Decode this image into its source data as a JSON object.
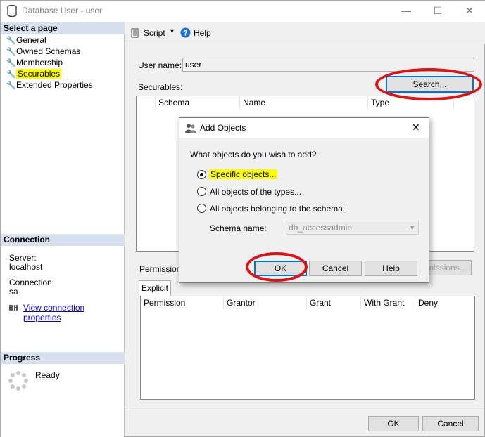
{
  "window": {
    "title": "Database User - user"
  },
  "left": {
    "select_page_header": "Select a page",
    "pages": [
      {
        "label": "General"
      },
      {
        "label": "Owned Schemas"
      },
      {
        "label": "Membership"
      },
      {
        "label": "Securables"
      },
      {
        "label": "Extended Properties"
      }
    ],
    "connection_header": "Connection",
    "server_label": "Server:",
    "server_value": "localhost",
    "connection_label": "Connection:",
    "connection_value": "sa",
    "view_props_link": "View connection properties",
    "progress_header": "Progress",
    "progress_status": "Ready"
  },
  "toolbar": {
    "script_label": "Script",
    "help_label": "Help"
  },
  "main": {
    "username_label": "User name:",
    "username_value": "user",
    "securables_label": "Securables:",
    "search_button": "Search...",
    "securables_columns": [
      "Schema",
      "Name",
      "Type"
    ],
    "permissions_label": "Permissions",
    "effective_button": "Effective Permissions...",
    "tab_explicit": "Explicit",
    "perm_columns": [
      "Permission",
      "Grantor",
      "Grant",
      "With Grant",
      "Deny"
    ]
  },
  "dialog": {
    "title": "Add Objects",
    "question": "What objects do you wish to add?",
    "options": [
      {
        "label": "Specific objects...",
        "checked": true
      },
      {
        "label": "All objects of the types..."
      },
      {
        "label": "All objects belonging to the schema:"
      }
    ],
    "schema_label": "Schema name:",
    "schema_value": "db_accessadmin",
    "ok_button": "OK",
    "cancel_button": "Cancel",
    "help_button": "Help"
  },
  "footer": {
    "ok_button": "OK",
    "cancel_button": "Cancel"
  },
  "colors": {
    "highlight": "#ffff00",
    "annotation_ring": "#e01010",
    "section_header": "#d6e0ef",
    "focus_border": "#0078d7"
  }
}
